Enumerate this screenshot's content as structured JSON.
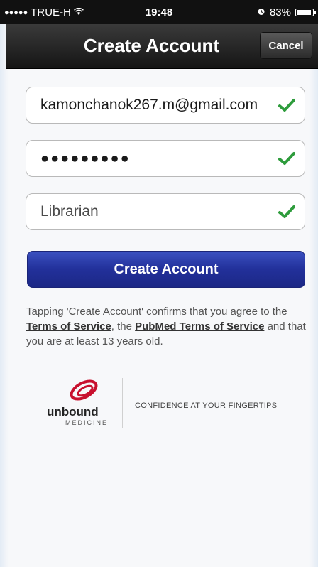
{
  "status_bar": {
    "signal": "●●●●●",
    "carrier": "TRUE-H",
    "time": "19:48",
    "battery": "83%",
    "battery_level": 0.83
  },
  "nav": {
    "title": "Create Account",
    "cancel_label": "Cancel"
  },
  "form": {
    "email_value": "kamonchanok267.m@gmail.com",
    "password_value": "●●●●●●●●●",
    "occupation_value": "Librarian",
    "check_color": "#2e9c3c"
  },
  "primary_button": {
    "label": "Create Account",
    "color": "#22309a"
  },
  "terms": {
    "prefix": "Tapping 'Create Account' confirms that you agree to the ",
    "link1": "Terms of Service",
    "middle": ", the ",
    "link2": "PubMed Terms of Service",
    "suffix": " and that you are at least 13 years old."
  },
  "brand": {
    "logo_word": "unbound",
    "logo_sub": "MEDICINE",
    "tagline": "CONFIDENCE AT YOUR FINGERTIPS",
    "logo_color": "#c8102e"
  }
}
